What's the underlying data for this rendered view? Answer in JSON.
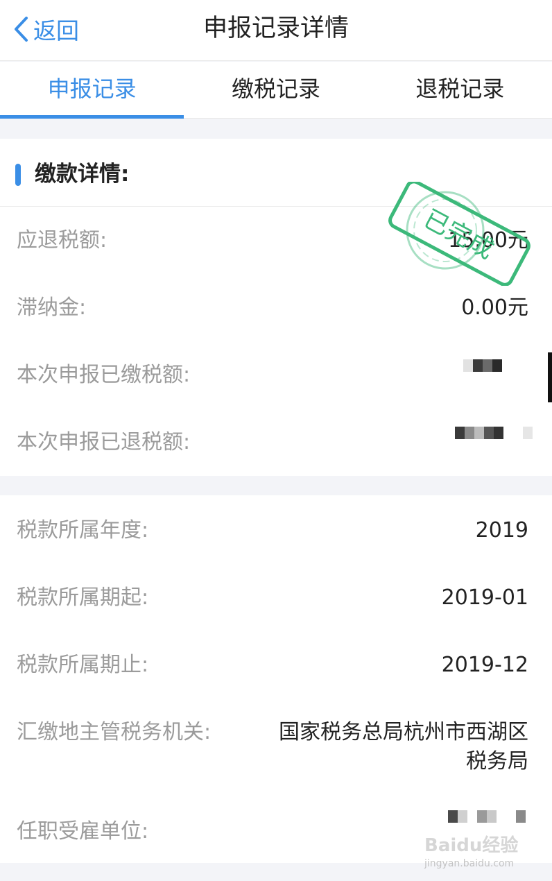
{
  "navbar": {
    "back_label": "返回",
    "title": "申报记录详情"
  },
  "tabs": [
    {
      "label": "申报记录",
      "active": true
    },
    {
      "label": "缴税记录",
      "active": false
    },
    {
      "label": "退税记录",
      "active": false
    }
  ],
  "payment_section": {
    "title": "缴款详情:",
    "rows": [
      {
        "label": "应退税额:",
        "value": "15.00元"
      },
      {
        "label": "滞纳金:",
        "value": "0.00元"
      },
      {
        "label": "本次申报已缴税额:",
        "value": ""
      },
      {
        "label": "本次申报已退税额:",
        "value": ""
      }
    ]
  },
  "stamp": {
    "text": "已完成",
    "color": "#3cb97a"
  },
  "period_section": {
    "rows": [
      {
        "label": "税款所属年度:",
        "value": "2019"
      },
      {
        "label": "税款所属期起:",
        "value": "2019-01"
      },
      {
        "label": "税款所属期止:",
        "value": "2019-12"
      },
      {
        "label": "汇缴地主管税务机关:",
        "value": "国家税务总局杭州市西湖区税务局"
      },
      {
        "label": "任职受雇单位:",
        "value": ""
      }
    ]
  },
  "watermark": {
    "main": "Baidu经验",
    "sub": "jingyan.baidu.com"
  },
  "colors": {
    "accent": "#3a8ee6",
    "label": "#9b9b9b",
    "text": "#222222",
    "background": "#f3f4f8"
  }
}
